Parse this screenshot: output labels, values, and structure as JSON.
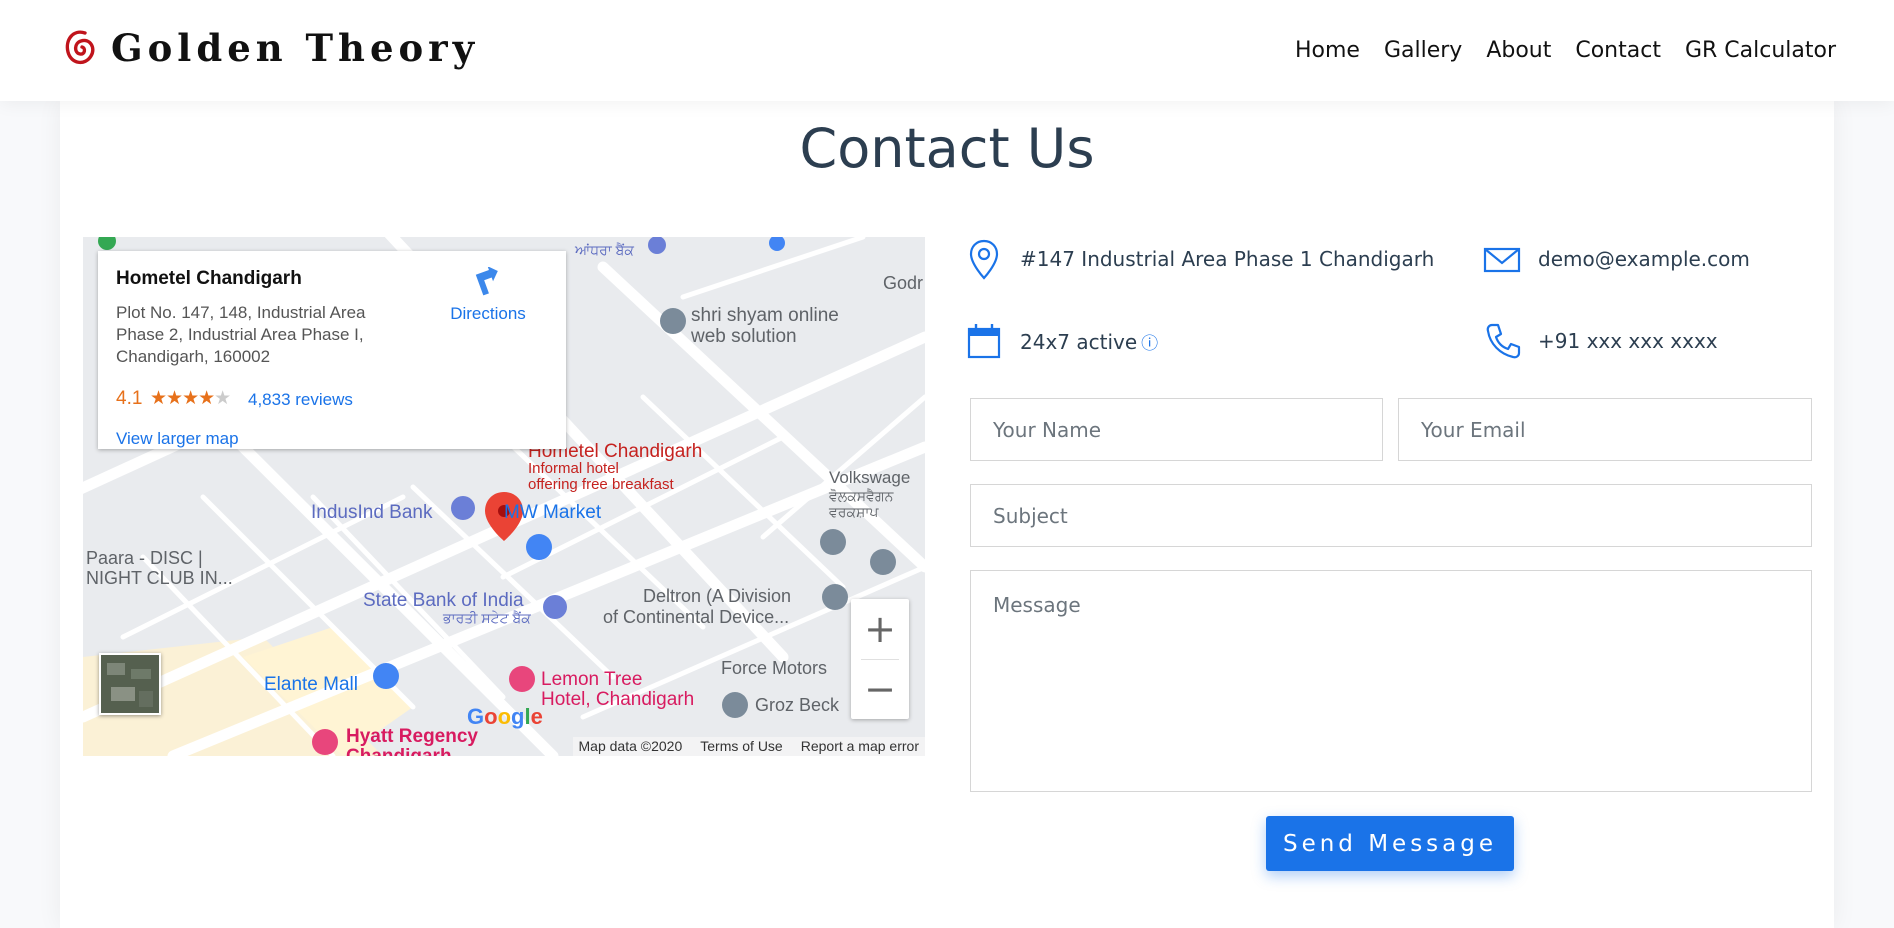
{
  "brand": {
    "name": "Golden Theory"
  },
  "nav": {
    "items": [
      "Home",
      "Gallery",
      "About",
      "Contact",
      "GR Calculator"
    ]
  },
  "page": {
    "title": "Contact Us"
  },
  "map": {
    "place_name": "Hometel Chandigarh",
    "address": "Plot No. 147, 148, Industrial Area Phase 2, Industrial Area Phase I, Chandigarh, 160002",
    "rating": "4.1",
    "stars": 4.1,
    "reviews": "4,833 reviews",
    "directions": "Directions",
    "view_larger": "View larger map",
    "google": "Google",
    "attribution": [
      "Map data ©2020",
      "Terms of Use",
      "Report a map error"
    ],
    "zoom_in": "+",
    "zoom_out": "−",
    "labels": {
      "hometel_name": "Hometel Chandigarh",
      "hometel_desc1": "Informal hotel",
      "hometel_desc2": "offering free breakfast",
      "shri1": "shri shyam online",
      "shri2": "web solution",
      "indusind": "IndusInd Bank",
      "mw": "MW Market",
      "paara1": "Paara - DISC |",
      "paara2": "NIGHT CLUB IN...",
      "sbi": "State Bank of India",
      "sbi_local": "ਭਾਰਤੀ ਸਟੇਟ ਬੈਂਕ",
      "deltron1": "Deltron (A Division",
      "deltron2": "of Continental Device...",
      "volks1": "Volkswage",
      "volks2": "ਵੋਲਕਸਵੈਗਨ",
      "volks3": "ਵਰਕਸ਼ਾਪ",
      "elante": "Elante Mall",
      "lemon1": "Lemon Tree",
      "lemon2": "Hotel, Chandigarh",
      "force": "Force Motors",
      "groz": "Groz Beck",
      "hyatt1": "Hyatt Regency",
      "hyatt2": "Chandigarh",
      "andhra": "ਆਂਧਰਾ ਬੈਂਕ",
      "godr": "Godr"
    }
  },
  "contact": {
    "address": "#147 Industrial Area Phase 1 Chandigarh",
    "email": "demo@example.com",
    "hours": "24x7 active",
    "hours_info": "ⓘ",
    "phone": "+91 xxx xxx xxxx"
  },
  "form": {
    "name_placeholder": "Your Name",
    "email_placeholder": "Your Email",
    "subject_placeholder": "Subject",
    "message_placeholder": "Message",
    "send_label": "Send Message"
  },
  "colors": {
    "accent": "#1a73e8",
    "text": "#2c3e50",
    "pin": "#ea4335"
  }
}
